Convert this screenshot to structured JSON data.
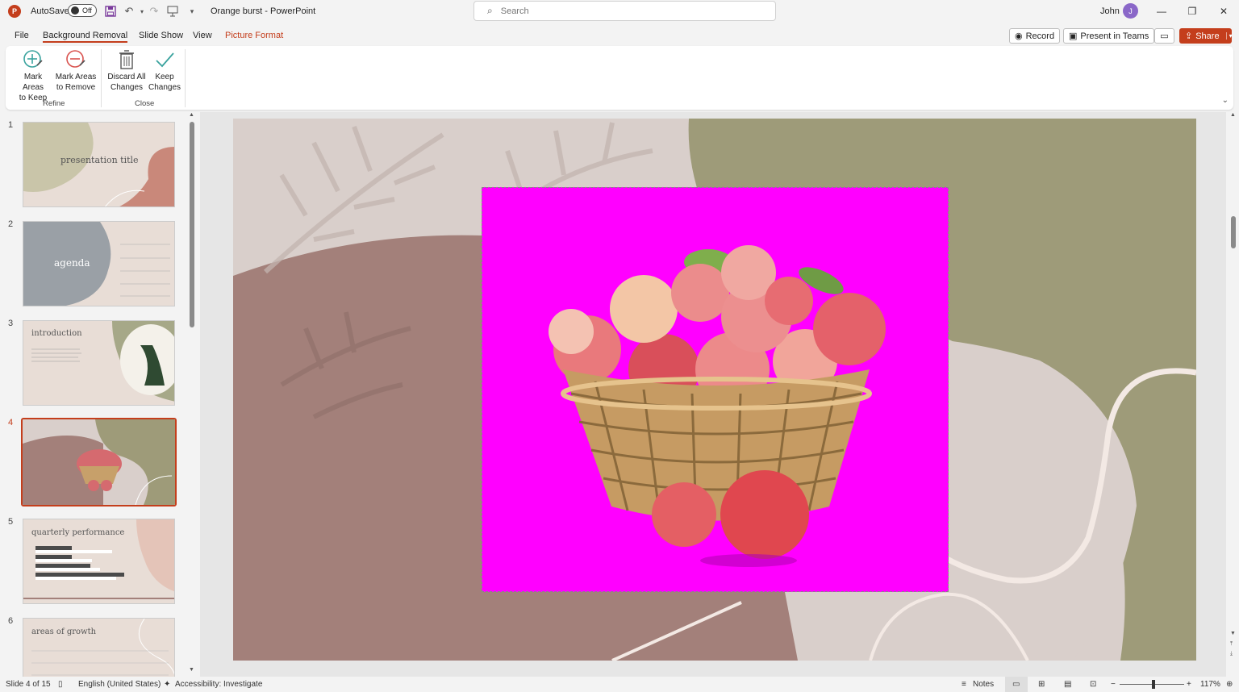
{
  "titlebar": {
    "autosave_label": "AutoSave",
    "autosave_state": "Off",
    "doc_title": "Orange burst  -  PowerPoint",
    "search_placeholder": "Search",
    "user_name": "John",
    "user_initial": "J"
  },
  "tabs": [
    {
      "label": "File"
    },
    {
      "label": "Background Removal"
    },
    {
      "label": "Slide Show"
    },
    {
      "label": "View"
    },
    {
      "label": "Picture Format"
    }
  ],
  "header_buttons": {
    "record": "Record",
    "present_in_teams": "Present in Teams",
    "share": "Share"
  },
  "ribbon": {
    "mark_keep": {
      "line1": "Mark Areas",
      "line2": "to Keep"
    },
    "mark_remove": {
      "line1": "Mark Areas",
      "line2": "to Remove"
    },
    "discard": {
      "line1": "Discard All",
      "line2": "Changes"
    },
    "keep": {
      "line1": "Keep",
      "line2": "Changes"
    },
    "group_refine": "Refine",
    "group_close": "Close"
  },
  "thumbnails": [
    {
      "num": "1",
      "title": "presentation title"
    },
    {
      "num": "2",
      "title": "agenda"
    },
    {
      "num": "3",
      "title": "introduction"
    },
    {
      "num": "4",
      "title": ""
    },
    {
      "num": "5",
      "title": "quarterly performance"
    },
    {
      "num": "6",
      "title": "areas of growth"
    }
  ],
  "status": {
    "slide_info": "Slide 4 of 15",
    "language": "English (United States)",
    "accessibility": "Accessibility: Investigate",
    "notes": "Notes",
    "zoom": "117%"
  },
  "colors": {
    "accent": "#c43e1c",
    "removal_magenta": "#ff00ff",
    "slide_olive": "#9e9b79",
    "slide_mauve": "#a3807a",
    "slide_beige": "#d9cfcb"
  }
}
